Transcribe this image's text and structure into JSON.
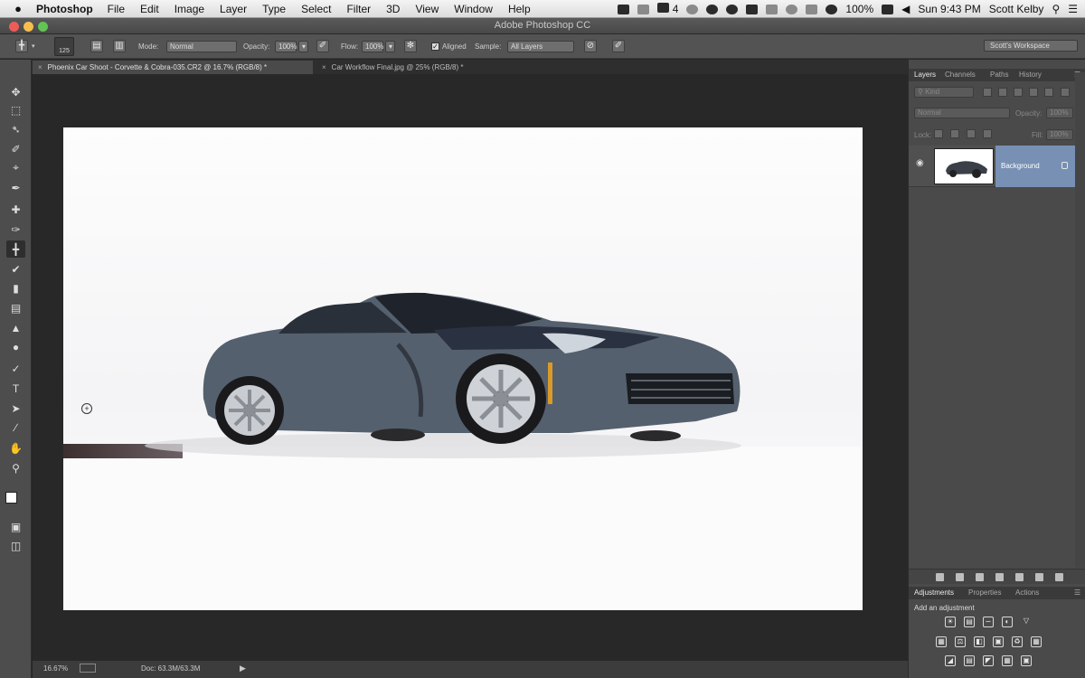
{
  "menubar": {
    "app_name": "Photoshop",
    "menus": [
      "File",
      "Edit",
      "Image",
      "Layer",
      "Type",
      "Select",
      "Filter",
      "3D",
      "View",
      "Window",
      "Help"
    ],
    "status": {
      "badge": "4",
      "battery": "100%",
      "clock": "Sun 9:43 PM",
      "user": "Scott Kelby"
    }
  },
  "window": {
    "title": "Adobe Photoshop CC"
  },
  "options": {
    "brush_size": "125",
    "mode_label": "Mode:",
    "mode_value": "Normal",
    "opacity_label": "Opacity:",
    "opacity_value": "100%",
    "flow_label": "Flow:",
    "flow_value": "100%",
    "aligned_label": "Aligned",
    "sample_label": "Sample:",
    "sample_value": "All Layers",
    "workspace": "Scott's Workspace"
  },
  "tabs": [
    {
      "label": "Phoenix Car Shoot - Corvette & Cobra-035.CR2 @ 16.7% (RGB/8) *"
    },
    {
      "label": "Car Workflow Final.jpg @ 25% (RGB/8) *"
    }
  ],
  "statusbar": {
    "zoom": "16.67%",
    "doc": "Doc: 63.3M/63.3M"
  },
  "layers_panel": {
    "tabs": [
      "Layers",
      "Channels",
      "Paths",
      "History"
    ],
    "kind": "Kind",
    "blend": "Normal",
    "opacity_label": "Opacity:",
    "opacity_value": "100%",
    "lock_label": "Lock:",
    "fill_label": "Fill:",
    "fill_value": "100%",
    "layer_name": "Background"
  },
  "adjustments_panel": {
    "tabs": [
      "Adjustments",
      "Properties",
      "Actions"
    ],
    "title": "Add an adjustment"
  },
  "colors": {
    "ui_dark": "#535353",
    "layer_selected": "#7890b4"
  }
}
